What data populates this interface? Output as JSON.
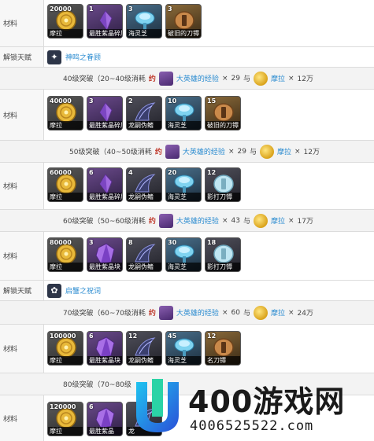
{
  "labels": {
    "materials": "材料",
    "unlock_talent": "解锁天赋",
    "times": "×",
    "and": "与"
  },
  "row1": {
    "items": [
      {
        "count": "20000",
        "name": "摩拉",
        "icon": "mora-coin-icon",
        "bg": "gold"
      },
      {
        "count": "1",
        "name": "最胜紫晶碎屑",
        "icon": "amethyst-sliver-icon",
        "bg": "purple"
      },
      {
        "count": "3",
        "name": "海灵芝",
        "icon": "sea-ganoderma-icon",
        "bg": "blue"
      },
      {
        "count": "3",
        "name": "破旧的刀镡",
        "icon": "old-handguard-icon",
        "bg": "orange"
      }
    ]
  },
  "talent1": {
    "name": "神鸣之眷顾",
    "icon": "talent-icon"
  },
  "sep40": {
    "title": "40级突破（20~40级消耗",
    "red": "约",
    "exp_item": "大英雄的经验",
    "exp_count": "29",
    "mora_item": "摩拉",
    "mora_count": "12万"
  },
  "row2": {
    "items": [
      {
        "count": "40000",
        "name": "摩拉",
        "icon": "mora-coin-icon",
        "bg": "gold"
      },
      {
        "count": "3",
        "name": "最胜紫晶碎屑",
        "icon": "amethyst-fragment-icon",
        "bg": "purple"
      },
      {
        "count": "2",
        "name": "龙嗣伪鳍",
        "icon": "dragonheir-fin-icon",
        "bg": "dark"
      },
      {
        "count": "10",
        "name": "海灵芝",
        "icon": "sea-ganoderma-icon",
        "bg": "blue"
      },
      {
        "count": "15",
        "name": "破旧的刀镡",
        "icon": "old-handguard-icon",
        "bg": "orange"
      }
    ]
  },
  "sep50": {
    "title": "50级突破（40~50级消耗",
    "red": "约",
    "exp_item": "大英雄的经验",
    "exp_count": "29",
    "mora_item": "摩拉",
    "mora_count": "12万"
  },
  "row3": {
    "items": [
      {
        "count": "60000",
        "name": "摩拉",
        "icon": "mora-coin-icon",
        "bg": "gold"
      },
      {
        "count": "6",
        "name": "最胜紫晶碎屑",
        "icon": "amethyst-fragment-icon",
        "bg": "purple"
      },
      {
        "count": "4",
        "name": "龙嗣伪鳍",
        "icon": "dragonheir-fin-icon",
        "bg": "dark"
      },
      {
        "count": "20",
        "name": "海灵芝",
        "icon": "sea-ganoderma-icon",
        "bg": "blue"
      },
      {
        "count": "12",
        "name": "影打刀镡",
        "icon": "kageuchi-handguard-icon",
        "bg": "dark"
      }
    ]
  },
  "sep60": {
    "title": "60级突破（50~60级消耗",
    "red": "约",
    "exp_item": "大英雄的经验",
    "exp_count": "43",
    "mora_item": "摩拉",
    "mora_count": "17万"
  },
  "row4": {
    "items": [
      {
        "count": "80000",
        "name": "摩拉",
        "icon": "mora-coin-icon",
        "bg": "gold"
      },
      {
        "count": "3",
        "name": "最胜紫晶块",
        "icon": "amethyst-chunk-icon",
        "bg": "purple"
      },
      {
        "count": "8",
        "name": "龙嗣伪鳍",
        "icon": "dragonheir-fin-icon",
        "bg": "dark"
      },
      {
        "count": "30",
        "name": "海灵芝",
        "icon": "sea-ganoderma-icon",
        "bg": "blue"
      },
      {
        "count": "18",
        "name": "影打刀镡",
        "icon": "kageuchi-handguard-icon",
        "bg": "dark"
      }
    ]
  },
  "talent2": {
    "name": "启蟹之祝词",
    "icon": "talent-icon"
  },
  "sep70": {
    "title": "70级突破（60~70级消耗",
    "red": "约",
    "exp_item": "大英雄的经验",
    "exp_count": "60",
    "mora_item": "摩拉",
    "mora_count": "24万"
  },
  "row5": {
    "items": [
      {
        "count": "100000",
        "name": "摩拉",
        "icon": "mora-coin-icon",
        "bg": "gold"
      },
      {
        "count": "6",
        "name": "最胜紫晶块",
        "icon": "amethyst-chunk-icon",
        "bg": "purple"
      },
      {
        "count": "12",
        "name": "龙嗣伪鳍",
        "icon": "dragonheir-fin-icon",
        "bg": "dark"
      },
      {
        "count": "45",
        "name": "海灵芝",
        "icon": "sea-ganoderma-icon",
        "bg": "blue"
      },
      {
        "count": "12",
        "name": "名刀镡",
        "icon": "famed-handguard-icon",
        "bg": "orange"
      }
    ]
  },
  "sep80": {
    "title": "80级突破（70~80级"
  },
  "row6": {
    "items": [
      {
        "count": "120000",
        "name": "摩拉",
        "icon": "mora-coin-icon",
        "bg": "gold"
      },
      {
        "count": "6",
        "name": "最胜紫晶",
        "icon": "amethyst-gemstone-icon",
        "bg": "purple"
      },
      {
        "count": "",
        "name": "龙",
        "icon": "dragonheir-fin-icon",
        "bg": "dark"
      }
    ]
  },
  "watermark": {
    "title": "400游戏网",
    "sub": "4006525522.com"
  }
}
